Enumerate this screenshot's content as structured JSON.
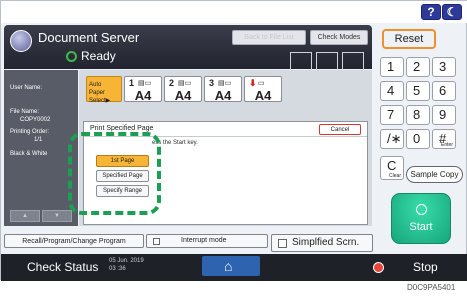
{
  "header": {
    "title": "Document Server",
    "status": "Ready",
    "back_label": "Back to File List",
    "check_modes_label": "Check Modes"
  },
  "info_panel": {
    "user_name_label": "User Name:",
    "file_name_label": "File Name:",
    "file_name_value": "COPY0002",
    "printing_order_label": "Printing Order:",
    "printing_order_value": "1/1",
    "color_mode": "Black & White"
  },
  "paper_trays": {
    "auto_label_line1": "Auto Paper",
    "auto_label_line2": "Select▶",
    "trays": [
      {
        "number": "1",
        "size": "A4"
      },
      {
        "number": "2",
        "size": "A4"
      },
      {
        "number": "3",
        "size": "A4"
      },
      {
        "number": "⬇",
        "size": "A4"
      }
    ]
  },
  "dialog": {
    "title": "Print Specified Page",
    "cancel_label": "Cancel",
    "message": "ess the Start key.",
    "options": [
      "1st Page",
      "Specified Page",
      "Specify Range"
    ]
  },
  "keypad": {
    "reset_label": "Reset",
    "keys": [
      {
        "main": "1",
        "sub": ""
      },
      {
        "main": "2",
        "sub": ""
      },
      {
        "main": "3",
        "sub": ""
      },
      {
        "main": "4",
        "sub": ""
      },
      {
        "main": "5",
        "sub": ""
      },
      {
        "main": "6",
        "sub": ""
      },
      {
        "main": "7",
        "sub": ""
      },
      {
        "main": "8",
        "sub": ""
      },
      {
        "main": "9",
        "sub": ""
      },
      {
        "main": "/∗",
        "sub": ""
      },
      {
        "main": "0",
        "sub": ""
      },
      {
        "main": "#",
        "sub": "Enter"
      },
      {
        "main": "C",
        "sub": "Clear"
      }
    ],
    "sample_copy_label": "Sample Copy",
    "start_label": "Start"
  },
  "bottom": {
    "recall_label": "Recall/Program/Change Program",
    "interrupt_label": "Interrupt mode",
    "simplified_label": "Simplfied Scrn."
  },
  "statusbar": {
    "check_status_label": "Check Status",
    "date": "05 Jun. 2019",
    "time": "03 :36",
    "stop_label": "Stop"
  },
  "caption": "D0C9PA5401",
  "colors": {
    "accent_orange": "#f6b536",
    "highlight_green": "#19a052",
    "start_green": "#16a67c",
    "reset_border": "#f0902d",
    "home_blue": "#2e63b0"
  }
}
